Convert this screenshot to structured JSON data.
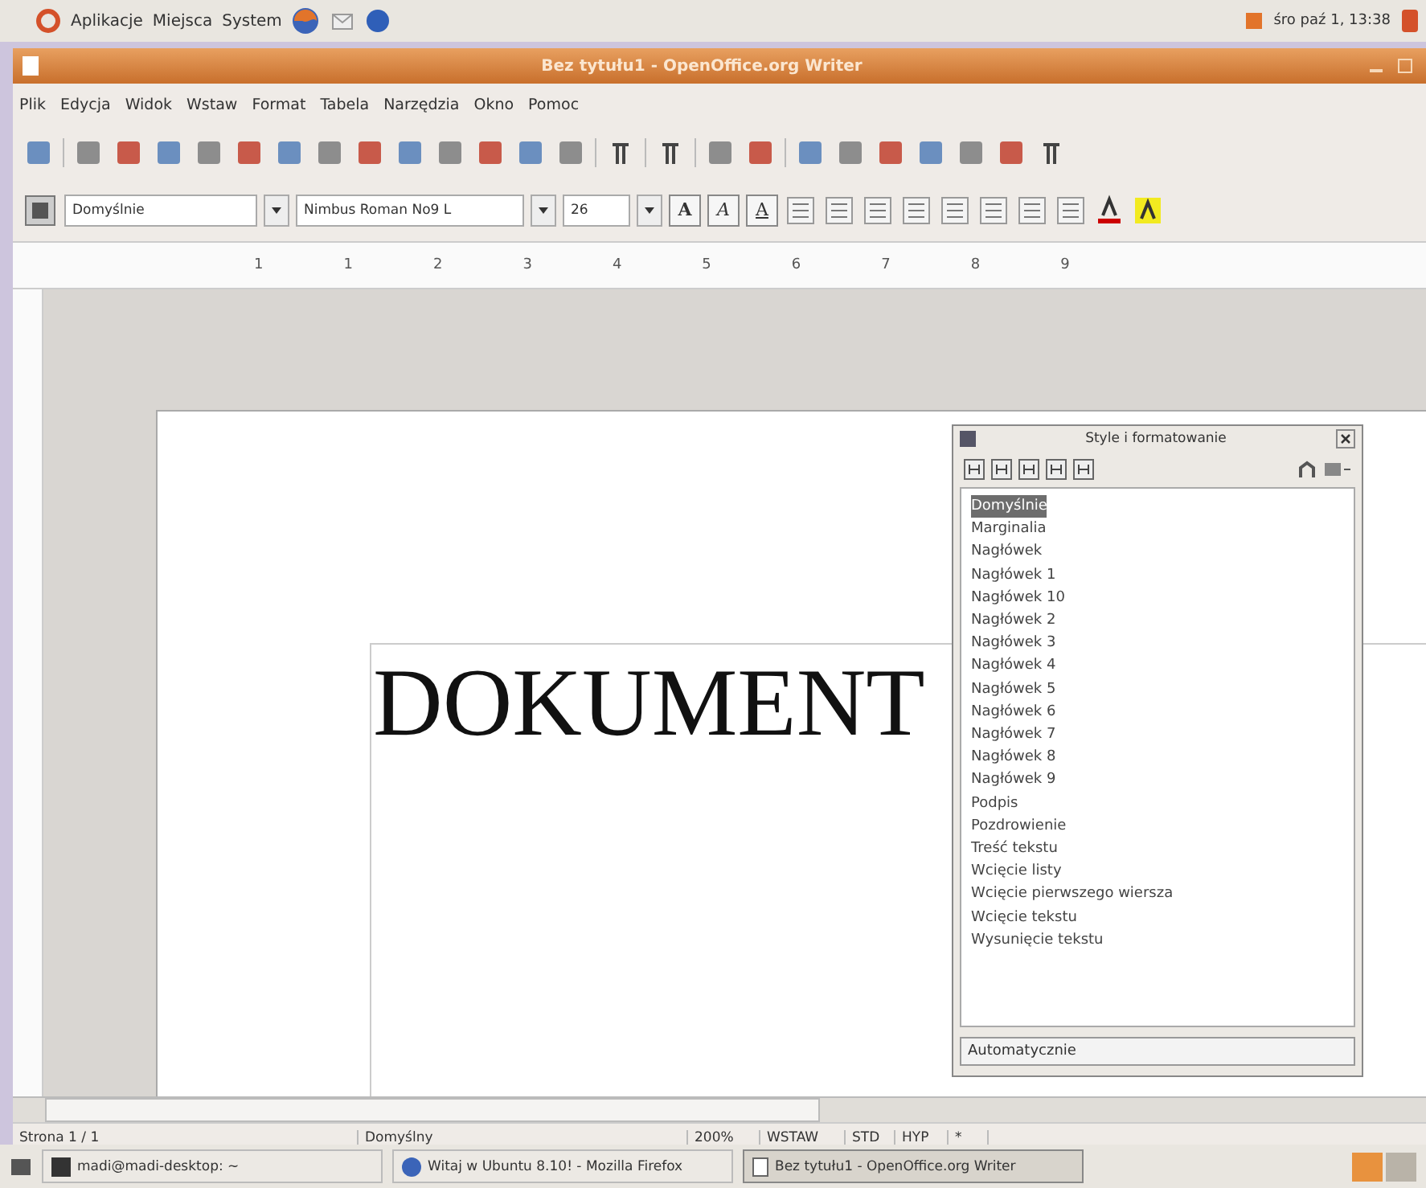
{
  "top_panel": {
    "menus": [
      "Aplikacje",
      "Miejsca",
      "System"
    ],
    "clock": "śro paź 1, 13:38"
  },
  "window": {
    "title": "Bez tytułu1 - OpenOffice.org Writer"
  },
  "menu_bar": [
    "Plik",
    "Edycja",
    "Widok",
    "Wstaw",
    "Format",
    "Tabela",
    "Narzędzia",
    "Okno",
    "Pomoc"
  ],
  "formatting": {
    "style": "Domyślnie",
    "font": "Nimbus Roman No9 L",
    "size": "26",
    "bold": {
      "label": "A",
      "on": false
    },
    "italic": {
      "label": "A",
      "on": false
    },
    "underline": {
      "label": "A",
      "on": false
    }
  },
  "ruler": [
    "1",
    "1",
    "2",
    "3",
    "4",
    "5",
    "6",
    "7",
    "8",
    "9"
  ],
  "document": {
    "text_visible": "DOKUMENT"
  },
  "styles_panel": {
    "title": "Style i formatowanie",
    "items": [
      {
        "label": "Domyślnie",
        "selected": true
      },
      {
        "label": "Marginalia",
        "selected": false
      },
      {
        "label": "Nagłówek",
        "selected": false
      },
      {
        "label": "Nagłówek 1",
        "selected": false
      },
      {
        "label": "Nagłówek 10",
        "selected": false
      },
      {
        "label": "Nagłówek 2",
        "selected": false
      },
      {
        "label": "Nagłówek 3",
        "selected": false
      },
      {
        "label": "Nagłówek 4",
        "selected": false
      },
      {
        "label": "Nagłówek 5",
        "selected": false
      },
      {
        "label": "Nagłówek 6",
        "selected": false
      },
      {
        "label": "Nagłówek 7",
        "selected": false
      },
      {
        "label": "Nagłówek 8",
        "selected": false
      },
      {
        "label": "Nagłówek 9",
        "selected": false
      },
      {
        "label": "Podpis",
        "selected": false
      },
      {
        "label": "Pozdrowienie",
        "selected": false
      },
      {
        "label": "Treść tekstu",
        "selected": false
      },
      {
        "label": "Wcięcie listy",
        "selected": false
      },
      {
        "label": "Wcięcie pierwszego wiersza",
        "selected": false
      },
      {
        "label": "Wcięcie tekstu",
        "selected": false
      },
      {
        "label": "Wysunięcie tekstu",
        "selected": false
      }
    ],
    "filter": "Automatycznie"
  },
  "status_bar": [
    "Strona 1 / 1",
    "Domyślny",
    "200%",
    "WSTAW",
    "STD",
    "HYP",
    "*"
  ],
  "taskbar": [
    {
      "label": "madi@madi-desktop: ~",
      "kind": "terminal",
      "selected": false
    },
    {
      "label": "Witaj w Ubuntu 8.10! - Mozilla Firefox",
      "kind": "browser",
      "selected": false
    },
    {
      "label": "Bez tytułu1 - OpenOffice.org Writer",
      "kind": "document",
      "selected": true
    }
  ]
}
